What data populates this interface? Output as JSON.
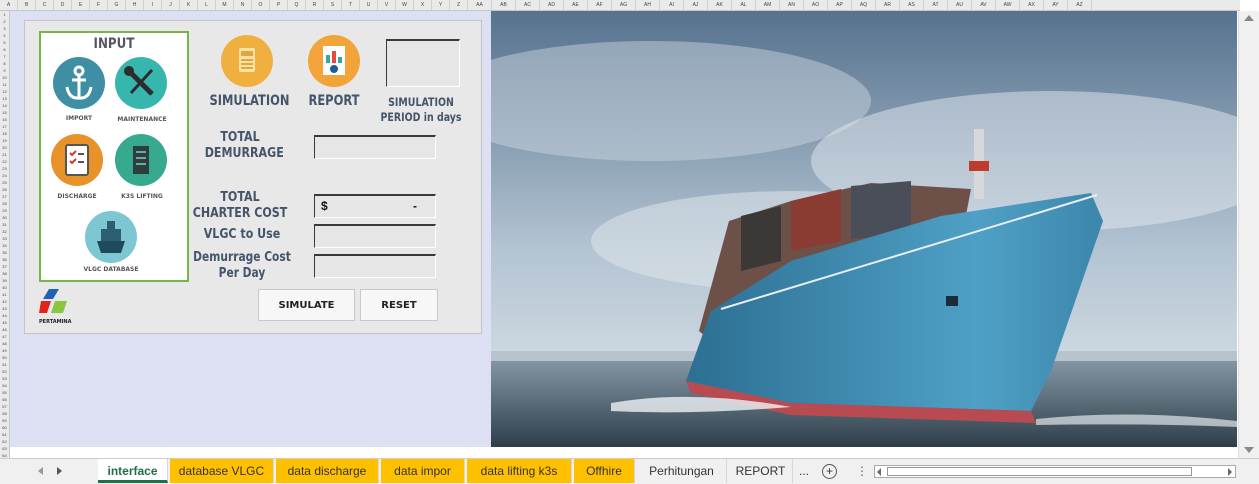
{
  "column_letters": [
    "A",
    "B",
    "C",
    "D",
    "E",
    "F",
    "G",
    "H",
    "I",
    "J",
    "K",
    "L",
    "M",
    "N",
    "O",
    "P",
    "Q",
    "R",
    "S",
    "T",
    "U",
    "V",
    "W",
    "X",
    "Y",
    "Z",
    "AA",
    "AB",
    "AC",
    "AD",
    "AE",
    "AF",
    "AG",
    "AH",
    "AI",
    "AJ",
    "AK",
    "AL",
    "AM",
    "AN",
    "AO",
    "AP",
    "AQ",
    "AR",
    "AS",
    "AT",
    "AU",
    "AV",
    "AW",
    "AX",
    "AY",
    "AZ"
  ],
  "input_panel": {
    "title": "INPUT",
    "import_label": "IMPORT",
    "maintenance_label": "MAINTENANCE",
    "discharge_label": "DISCHARGE",
    "k3s_lifting_label": "K3S LIFTING",
    "vlgc_database_label": "VLGC DATABASE"
  },
  "logo_text": "PERTAMINA",
  "main": {
    "simulation_label": "SIMULATION",
    "report_label": "REPORT",
    "simulation_period_label": "SIMULATION PERIOD in days",
    "total_demurrage_label": "TOTAL DEMURRAGE",
    "total_charter_cost_label": "TOTAL CHARTER COST",
    "total_charter_cost_currency": "$",
    "total_charter_cost_value": "-",
    "vlgc_to_use_label": "VLGC to Use",
    "demurrage_cost_per_day_label": "Demurrage Cost Per Day",
    "simulate_button": "SIMULATE",
    "reset_button": "RESET"
  },
  "sheet_tabs": [
    {
      "label": "interface",
      "style": "active"
    },
    {
      "label": "database VLGC",
      "style": "yellow"
    },
    {
      "label": "data discharge",
      "style": "yellow"
    },
    {
      "label": "data impor",
      "style": "yellow"
    },
    {
      "label": "data lifting k3s",
      "style": "yellow"
    },
    {
      "label": "Offhire",
      "style": "yellow"
    },
    {
      "label": "Perhitungan",
      "style": "plain"
    },
    {
      "label": "REPORT",
      "style": "plain"
    }
  ],
  "tab_overflow": "...",
  "add_sheet_icon": "plus-circle-icon",
  "colors": {
    "accent_green": "#1e7145",
    "tab_yellow": "#ffc000",
    "input_border": "#77b54a",
    "label_color": "#44546a"
  }
}
